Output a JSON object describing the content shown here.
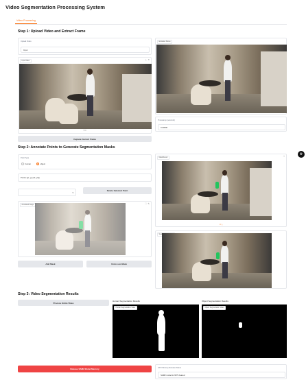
{
  "app": {
    "title": "Video Segmentation Processing System"
  },
  "tabs": [
    {
      "label": "Video Processing"
    }
  ],
  "step1": {
    "heading": "Step 1: Upload Video and Extract Frame",
    "file_input_label": "Upload Video",
    "file_value": "Input",
    "video_chip": "Input Video",
    "frame_chip": "Extracted Frame",
    "timestamp_label": "Timestamp (seconds)",
    "timestamp_value": "0.00000",
    "capture_button": "Capture Current Frame"
  },
  "step2": {
    "heading": "Step 2: Annotate Points to Generate Segmentation Masks",
    "point_type_label": "Point Type",
    "options": [
      "human",
      "object"
    ],
    "selected": "object",
    "points_text": "Points: [[x, y], [x2, y2]]",
    "delete_button": "Delete Selected Point",
    "annotated_chip": "Annotated Image",
    "mask_chip": "Mask Result",
    "right_mask_chip": "Segmentation Result",
    "add_mask_button": "Add Mask",
    "undo_mask_button": "Undo Last Mask"
  },
  "step3": {
    "heading": "Step 3: Video Segmentation Results",
    "process_button": "Process Entire Video",
    "human_results_label": "Human Segmentation Results",
    "object_results_label": "Object Segmentation Results",
    "human_chip": "Human Segmentation Video",
    "object_chip": "Object Segmentation Video"
  },
  "footer": {
    "release_button": "Release SAM2 Model Memory",
    "status_label": "GPU Memory Release Status",
    "status_value": "SAM2 model is NOT cleared"
  },
  "colors": {
    "accent": "#f97316",
    "danger": "#ef4444"
  }
}
